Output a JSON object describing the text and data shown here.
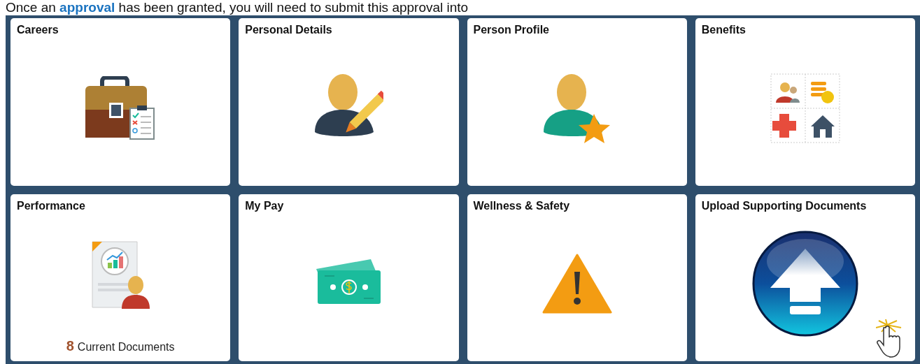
{
  "intro_text": "Once an **approval** has been granted, you will need to submit this approval into",
  "tiles": [
    {
      "title": "Careers"
    },
    {
      "title": "Personal Details"
    },
    {
      "title": "Person Profile"
    },
    {
      "title": "Benefits"
    },
    {
      "title": "Performance",
      "count": "8",
      "count_label": "Current Documents"
    },
    {
      "title": "My Pay"
    },
    {
      "title": "Wellness & Safety"
    },
    {
      "title": "Upload Supporting Documents"
    }
  ]
}
